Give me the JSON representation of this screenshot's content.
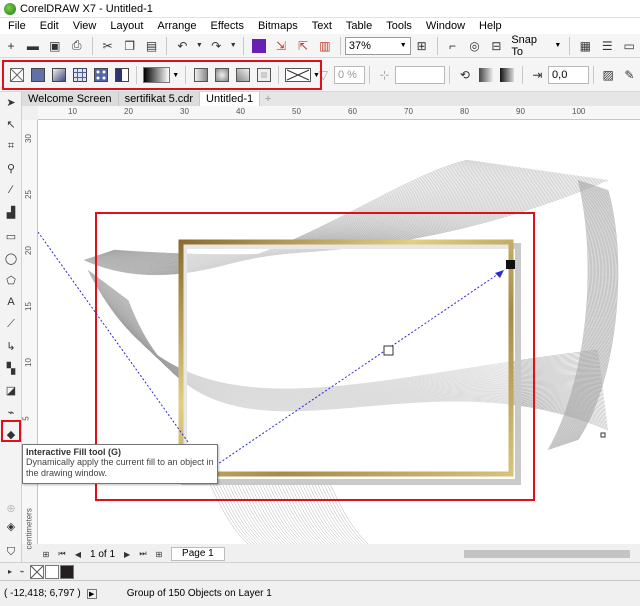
{
  "title": {
    "text": "CorelDRAW X7 - Untitled-1"
  },
  "menu": [
    "File",
    "Edit",
    "View",
    "Layout",
    "Arrange",
    "Effects",
    "Bitmaps",
    "Text",
    "Table",
    "Tools",
    "Window",
    "Help"
  ],
  "standard_toolbar": {
    "zoom_value": "37%",
    "snap_label": "Snap To"
  },
  "property_bar": {
    "transparency": "0 %",
    "rotation": "0,0"
  },
  "tabs": [
    "Welcome Screen",
    "sertifikat 5.cdr",
    "Untitled-1"
  ],
  "active_tab": "Untitled-1",
  "hruler_ticks": [
    "10",
    "20",
    "30",
    "40",
    "50",
    "60",
    "70",
    "80",
    "90",
    "100"
  ],
  "vruler_ticks": [
    "30",
    "25",
    "20",
    "15",
    "10",
    "5",
    "0"
  ],
  "vruler_unit": "centimeters",
  "tooltip": {
    "title": "Interactive Fill tool (G)",
    "description": "Dynamically apply the current fill to an object in the drawing window."
  },
  "pagebar": {
    "page_count": "1 of 1",
    "page_tab": "Page 1"
  },
  "statusbar": {
    "coordinates": "( -12,418; 6,797 )",
    "info": "Group of 150 Objects on Layer 1"
  },
  "colors": {
    "highlight": "#e0101a",
    "frame_gold_light": "#e0cf84",
    "frame_gold_dark": "#8b6b2e",
    "vector_line": "#2a2ad9"
  }
}
